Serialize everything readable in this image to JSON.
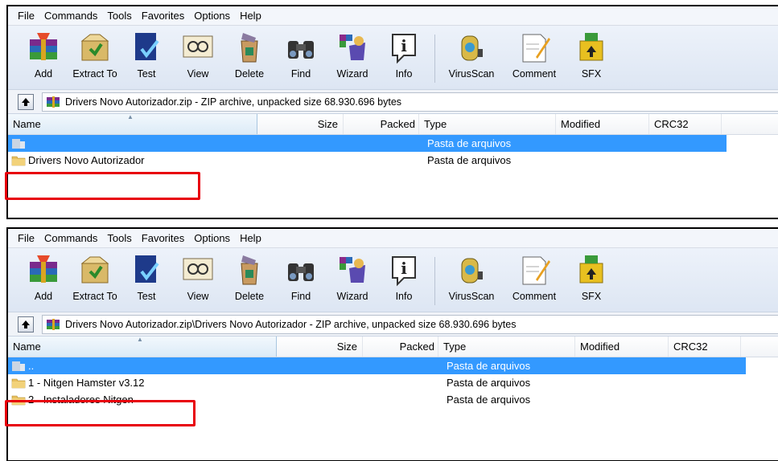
{
  "menu": [
    "File",
    "Commands",
    "Tools",
    "Favorites",
    "Options",
    "Help"
  ],
  "toolbar": [
    {
      "label": "Add",
      "icon": "add-archive-icon"
    },
    {
      "label": "Extract To",
      "icon": "extract-to-icon"
    },
    {
      "label": "Test",
      "icon": "test-icon"
    },
    {
      "label": "View",
      "icon": "view-icon"
    },
    {
      "label": "Delete",
      "icon": "delete-icon"
    },
    {
      "label": "Find",
      "icon": "find-icon"
    },
    {
      "label": "Wizard",
      "icon": "wizard-icon"
    },
    {
      "label": "Info",
      "icon": "info-icon"
    },
    {
      "label": "VirusScan",
      "icon": "virusscan-icon"
    },
    {
      "label": "Comment",
      "icon": "comment-icon"
    },
    {
      "label": "SFX",
      "icon": "sfx-icon"
    }
  ],
  "columns": {
    "name": "Name",
    "size": "Size",
    "packed": "Packed",
    "type": "Type",
    "modified": "Modified",
    "crc": "CRC32"
  },
  "pane1": {
    "path": "Drivers Novo Autorizador.zip - ZIP archive, unpacked size 68.930.696 bytes",
    "rows": [
      {
        "name": "",
        "type": "Pasta de arquivos",
        "selected": true
      },
      {
        "name": "Drivers Novo Autorizador",
        "type": "Pasta de arquivos",
        "selected": false
      }
    ]
  },
  "pane2": {
    "path": "Drivers Novo Autorizador.zip\\Drivers Novo Autorizador - ZIP archive, unpacked size 68.930.696 bytes",
    "rows": [
      {
        "name": "..",
        "type": "Pasta de arquivos",
        "selected": true
      },
      {
        "name": "1 - Nitgen Hamster v3.12",
        "type": "Pasta de arquivos",
        "selected": false
      },
      {
        "name": "2 - Instaladores Nitgen",
        "type": "Pasta de arquivos",
        "selected": false
      }
    ]
  },
  "colors": {
    "selection": "#3399ff",
    "highlight_box": "#e8000b",
    "toolbar_bg": "#dde6f3"
  }
}
